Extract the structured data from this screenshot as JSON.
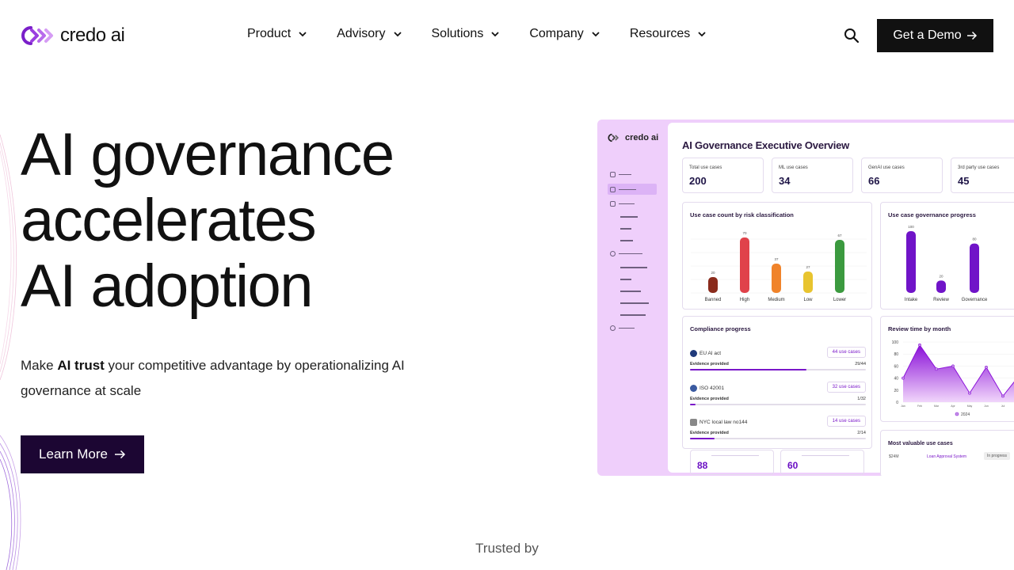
{
  "brand": {
    "name": "credo ai",
    "accent": "#8b2fd6",
    "dark_button": "#111111",
    "learn_button": "#1c0633"
  },
  "nav": {
    "items": [
      {
        "label": "Product"
      },
      {
        "label": "Advisory"
      },
      {
        "label": "Solutions"
      },
      {
        "label": "Company"
      },
      {
        "label": "Resources"
      }
    ],
    "search_icon": "search-icon",
    "cta_label": "Get a Demo"
  },
  "hero": {
    "title_lines": [
      "AI governance",
      "accelerates",
      "AI adoption"
    ],
    "sub_prefix": "Make",
    "sub_bold": "AI trust",
    "sub_rest": "your competitive advantage by operationalizing AI governance at scale",
    "cta_label": "Learn More"
  },
  "trusted_label": "Trusted by",
  "dashboard": {
    "logo": "credo ai",
    "title": "AI Governance Executive Overview",
    "kpis": [
      {
        "label": "Total use cases",
        "value": "200"
      },
      {
        "label": "ML use cases",
        "value": "34"
      },
      {
        "label": "GenAI use cases",
        "value": "66"
      },
      {
        "label": "3rd party use cases",
        "value": "45"
      }
    ],
    "risk_chart": {
      "title": "Use case count by risk classification",
      "categories": [
        "Banned",
        "High",
        "Medium",
        "Low",
        "Lower"
      ],
      "values": [
        20,
        70,
        37,
        27,
        67
      ],
      "colors": [
        "#8a2b1c",
        "#e0424a",
        "#f0832a",
        "#e8c42f",
        "#3b9a3f"
      ]
    },
    "progress_chart": {
      "title": "Use case governance progress",
      "categories": [
        "Intake",
        "Review",
        "Governance"
      ],
      "values": [
        100,
        20,
        80
      ],
      "color": "#7014c8"
    },
    "compliance": {
      "title": "Compliance progress",
      "rows": [
        {
          "name": "EU AI act",
          "tag": "44 use cases",
          "evidence_label": "Evidence provided",
          "count": "29/44",
          "progress": 0.66,
          "dot": "#1f3a7a"
        },
        {
          "name": "ISO 42001",
          "tag": "32 use cases",
          "evidence_label": "Evidence provided",
          "count": "1/32",
          "progress": 0.03,
          "dot": "#3a5aa0"
        },
        {
          "name": "NYC local law no144",
          "tag": "14 use cases",
          "evidence_label": "Evidence provided",
          "count": "2/14",
          "progress": 0.14,
          "dot": "#888888"
        }
      ],
      "mini_values": [
        "88",
        "60"
      ]
    },
    "review_chart": {
      "title": "Review time by month",
      "type": "area",
      "y_ticks": [
        "100",
        "80",
        "60",
        "40",
        "20",
        "0"
      ],
      "x": [
        "Jan",
        "Feb",
        "Mar",
        "Apr",
        "May",
        "Jun",
        "Jul",
        "Aug",
        "Sep"
      ],
      "values": [
        40,
        95,
        55,
        60,
        15,
        58,
        10,
        45,
        30
      ],
      "legend": "2024",
      "ylim": [
        0,
        100
      ]
    },
    "valuable": {
      "title": "Most valuable use cases",
      "row_value": "$24M",
      "row_name": "Loan Approval System",
      "row_tag": "In progress"
    }
  }
}
